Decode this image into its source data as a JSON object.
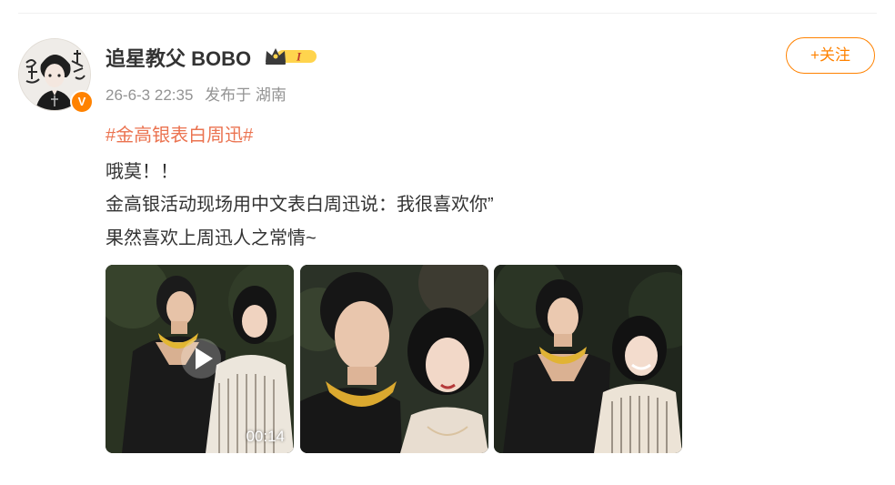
{
  "post": {
    "user_name": "追星教父 BOBO",
    "vip_level": "I",
    "verified_mark": "V",
    "time": "26-6-3 22:35",
    "source": "发布于 湖南",
    "follow_label": "+关注",
    "topic": "#金高银表白周迅#",
    "lines": [
      "哦莫！！",
      "金高银活动现场用中文表白周迅说：我很喜欢你”",
      "果然喜欢上周迅人之常情~"
    ],
    "media": [
      {
        "kind": "video",
        "duration": "00:14",
        "icon": "play-icon"
      },
      {
        "kind": "image"
      },
      {
        "kind": "image"
      }
    ]
  },
  "icons": {
    "vip": "crown-icon",
    "verified": "verified-badge-icon",
    "play": "play-icon"
  },
  "colors": {
    "accent": "#ff8200",
    "topic": "#eb7350",
    "text": "#333333",
    "meta": "#939393"
  }
}
